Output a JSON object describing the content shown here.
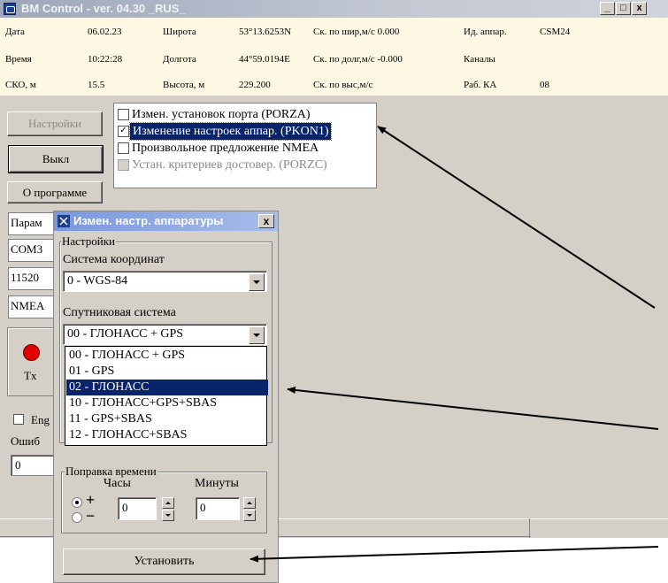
{
  "window": {
    "title": "BM Control - ver. 04.30 _RUS_",
    "minimize": "_",
    "maximize": "□",
    "close": "x"
  },
  "info": {
    "row1": [
      "Дата",
      "06.02.23",
      "Широта",
      "53°13.6253N",
      "Ск. по шир,м/с 0.000",
      "Ид. аппар.",
      "CSM24"
    ],
    "row2": [
      "Время",
      "10:22:28",
      "Долгота",
      "44°59.0194E",
      "Ск. по долг,м/с -0.000",
      "Каналы",
      ""
    ],
    "row3": [
      "СКО, м",
      "15.5",
      "Высота, м",
      "229.200",
      "Ск. по выс,м/с",
      "Раб. КА",
      "08"
    ]
  },
  "left": {
    "settings_button": "Настройки",
    "off_button": "Выкл",
    "about_button": "О программе",
    "param_cell": "Парам",
    "com_cell": "COM3",
    "baud_cell": "11520",
    "nmea_cell": "NMEA",
    "tx_label": "Tx",
    "eng_label": "Eng",
    "errors_label": "Ошиб",
    "errors_value": "0"
  },
  "menu": {
    "items": [
      {
        "label": "Измен. установок порта (PORZA)",
        "checked": false
      },
      {
        "label": "Изменение настроек аппар. (PKON1)",
        "checked": true
      },
      {
        "label": "Произвольное предложение NMEA",
        "checked": false
      },
      {
        "label": "Устан. критериев достовер. (PORZC)",
        "checked": false
      }
    ]
  },
  "dialog": {
    "title": "Измен. настр. аппаратуры",
    "close": "x",
    "group_settings": "Настройки",
    "coord_label": "Система координат",
    "coord_value": "0 - WGS-84",
    "sat_label": "Спутниковая система",
    "sat_value": "00 - ГЛОНАСС + GPS",
    "sat_options": [
      "00 - ГЛОНАСС + GPS",
      "01 - GPS",
      "02 - ГЛОНАСС",
      "10 - ГЛОНАСС+GPS+SBAS",
      "11 - GPS+SBAS",
      "12 - ГЛОНАСС+SBAS"
    ],
    "time_group": "Поправка времени",
    "hours_label": "Часы",
    "minutes_label": "Минуты",
    "plus_sign": "+",
    "minus_sign": "−",
    "hours_value": "0",
    "minutes_value": "0",
    "apply_button": "Установить"
  },
  "colors": {
    "selection": "#0a246a",
    "face": "#d4d0c8",
    "info_bg": "#fdf8e4",
    "led": "#e00000"
  }
}
